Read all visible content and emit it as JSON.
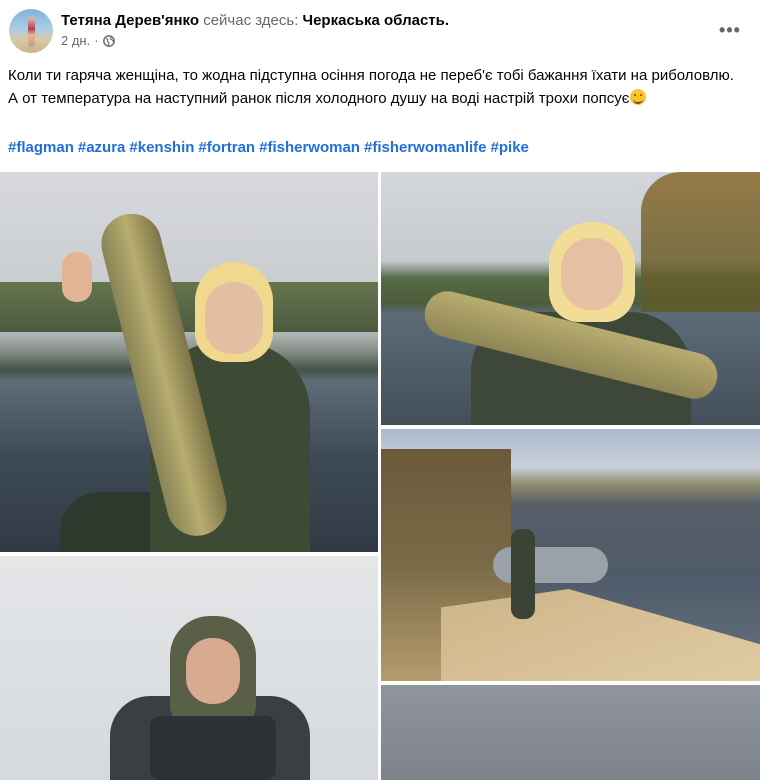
{
  "post": {
    "author_name": "Тетяна Дерев'янко",
    "here_text": "сейчас здесь:",
    "location": "Черкаська область.",
    "time_ago": "2 дн.",
    "dot": "·",
    "text": "Коли ти гаряча женщіна, то жодна підступна осіння погода не переб'є тобі бажання їхати на риболовлю. А от температура на наступний ранок після холодного душу на воді настрій трохи попсує",
    "hashtags": [
      "#flagman",
      "#azura",
      "#kenshin",
      "#fortran",
      "#fisherwoman",
      "#fisherwomanlife",
      "#pike"
    ],
    "more_label": "•••",
    "icons": {
      "privacy": "globe-icon",
      "more": "more-options-icon",
      "emoji": "grinning-sweat-emoji-icon"
    }
  },
  "colors": {
    "hashtag": "#216fdb",
    "secondary_text": "#65676b",
    "primary_text": "#050505"
  }
}
